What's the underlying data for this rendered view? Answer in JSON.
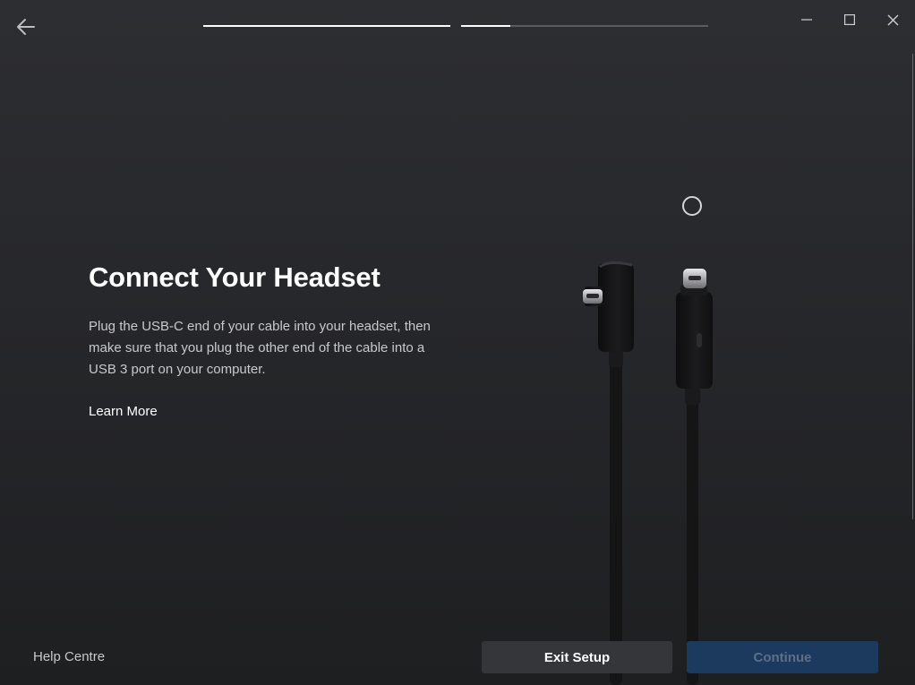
{
  "header": {
    "back_icon": "arrow-left-icon",
    "progress": [
      {
        "step": 1,
        "fill": 1.0
      },
      {
        "step": 2,
        "fill": 0.2
      }
    ],
    "window_controls": {
      "minimize_icon": "minimize-icon",
      "maximize_icon": "maximize-icon",
      "close_icon": "close-icon"
    }
  },
  "main": {
    "title": "Connect Your Headset",
    "description": "Plug the USB-C end of your cable into your headset, then make sure that you plug the other end of the cable into a USB 3 port on your computer.",
    "learn_more": "Learn More",
    "illustration_icon": "usb-c-cable-illustration"
  },
  "footer": {
    "help": "Help Centre",
    "exit": "Exit Setup",
    "continue": "Continue"
  },
  "colors": {
    "background": "#27282b",
    "text": "#ffffff",
    "muted_text": "#c9c9cb",
    "exit_button": "#35363a",
    "continue_button": "#1c3a5e",
    "continue_text": "#5b6f88"
  }
}
